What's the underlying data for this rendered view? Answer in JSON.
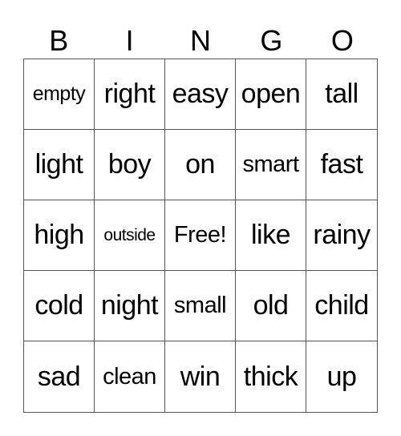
{
  "header": [
    "B",
    "I",
    "N",
    "G",
    "O"
  ],
  "cells": [
    [
      "empty",
      "right",
      "easy",
      "open",
      "tall"
    ],
    [
      "light",
      "boy",
      "on",
      "smart",
      "fast"
    ],
    [
      "high",
      "outside",
      "Free!",
      "like",
      "rainy"
    ],
    [
      "cold",
      "night",
      "small",
      "old",
      "child"
    ],
    [
      "sad",
      "clean",
      "win",
      "thick",
      "up"
    ]
  ],
  "colors": {
    "border": "#555555",
    "text": "#000000",
    "background": "#ffffff"
  }
}
